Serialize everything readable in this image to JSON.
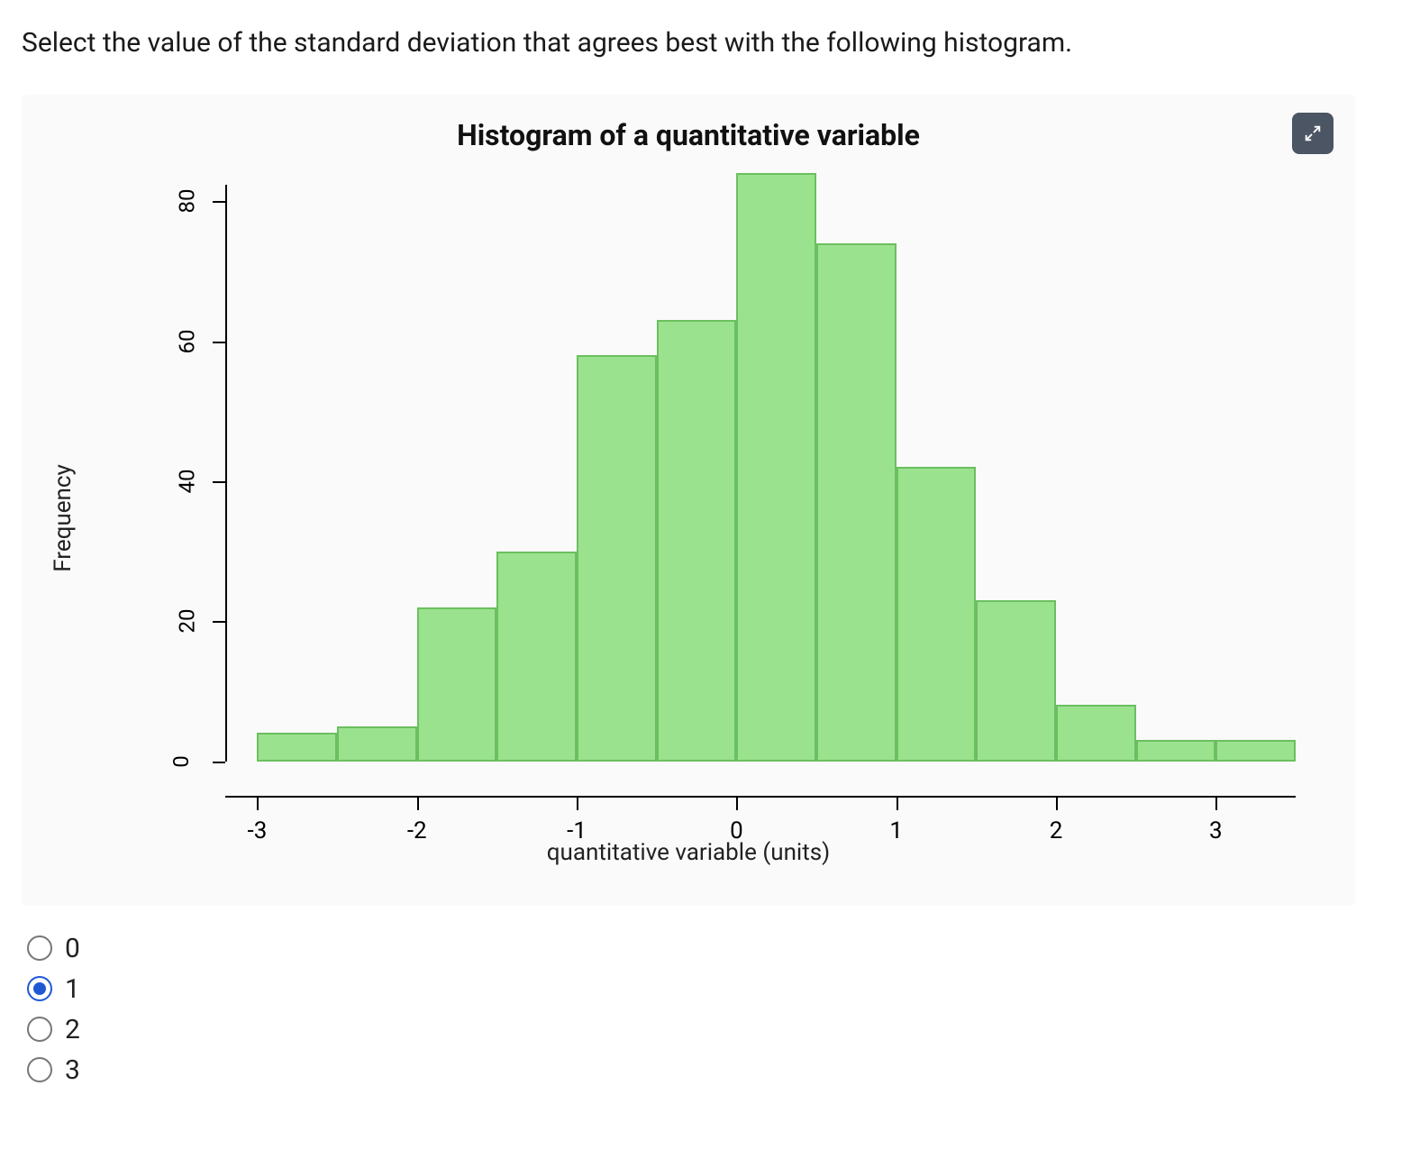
{
  "question_text": "Select the value of the standard deviation that agrees best with the following histogram.",
  "chart_data": {
    "type": "bar",
    "title": "Histogram of a quantitative variable",
    "xlabel": "quantitative variable (units)",
    "ylabel": "Frequency",
    "ylim": [
      0,
      85
    ],
    "y_ticks": [
      0,
      20,
      40,
      60,
      80
    ],
    "x_ticks": [
      -3,
      -2,
      -1,
      0,
      1,
      2,
      3
    ],
    "bin_width": 0.5,
    "bin_lefts": [
      -3.0,
      -2.5,
      -2.0,
      -1.5,
      -1.0,
      -0.5,
      0.0,
      0.5,
      1.0,
      1.5,
      2.0,
      2.5,
      3.0
    ],
    "values": [
      4,
      5,
      22,
      30,
      58,
      63,
      84,
      74,
      42,
      23,
      8,
      3,
      3
    ],
    "bar_color": "#9be28f",
    "bar_border": "#6bbf5f"
  },
  "options": [
    {
      "label": "0",
      "selected": false
    },
    {
      "label": "1",
      "selected": true
    },
    {
      "label": "2",
      "selected": false
    },
    {
      "label": "3",
      "selected": false
    }
  ],
  "icons": {
    "expand": "expand-icon"
  }
}
